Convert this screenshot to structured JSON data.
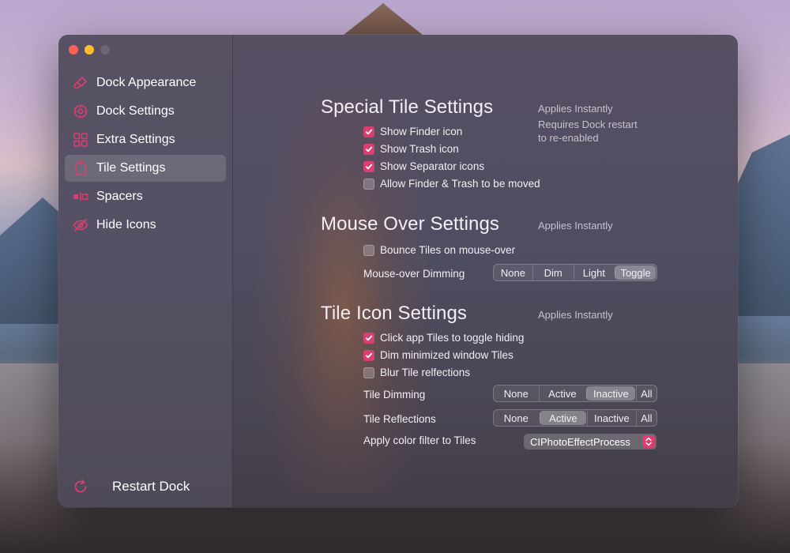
{
  "window": {
    "traffic_colors": [
      "#fe5f57",
      "#febc2e",
      "#6b6670"
    ]
  },
  "sidebar": {
    "items": [
      {
        "label": "Dock Appearance",
        "icon": "paintbrush-icon"
      },
      {
        "label": "Dock Settings",
        "icon": "gear-icon"
      },
      {
        "label": "Extra Settings",
        "icon": "grid-icon"
      },
      {
        "label": "Tile Settings",
        "icon": "tile-icon",
        "selected": true
      },
      {
        "label": "Spacers",
        "icon": "spacer-icon"
      },
      {
        "label": "Hide Icons",
        "icon": "eye-slash-icon"
      }
    ],
    "restart_label": "Restart Dock",
    "accent": "#d9406f"
  },
  "special": {
    "title": "Special Tile Settings",
    "note1": "Applies Instantly",
    "note2a": "Requires Dock restart",
    "note2b": "to re-enabled",
    "options": [
      {
        "label": "Show Finder icon",
        "checked": true
      },
      {
        "label": "Show Trash icon",
        "checked": true
      },
      {
        "label": "Show Separator icons",
        "checked": true
      },
      {
        "label": "Allow Finder & Trash to be moved",
        "checked": false
      }
    ]
  },
  "mouseover": {
    "title": "Mouse Over Settings",
    "note": "Applies Instantly",
    "bounce_label": "Bounce Tiles on mouse-over",
    "bounce_checked": false,
    "dimming_label": "Mouse-over Dimming",
    "dimming_options": [
      "None",
      "Dim",
      "Light",
      "Toggle"
    ],
    "dimming_selected": "Toggle"
  },
  "tileicon": {
    "title": "Tile Icon Settings",
    "note": "Applies Instantly",
    "options": [
      {
        "label": "Click app Tiles to toggle hiding",
        "checked": true
      },
      {
        "label": "Dim minimized window Tiles",
        "checked": true
      },
      {
        "label": "Blur Tile relfections",
        "checked": false
      }
    ],
    "dimming_label": "Tile Dimming",
    "dimming_options": [
      "None",
      "Active",
      "Inactive",
      "All"
    ],
    "dimming_selected": "Inactive",
    "reflections_label": "Tile Reflections",
    "reflections_options": [
      "None",
      "Active",
      "Inactive",
      "All"
    ],
    "reflections_selected": "Active",
    "filter_label": "Apply color filter to Tiles",
    "filter_value": "CIPhotoEffectProcess"
  }
}
